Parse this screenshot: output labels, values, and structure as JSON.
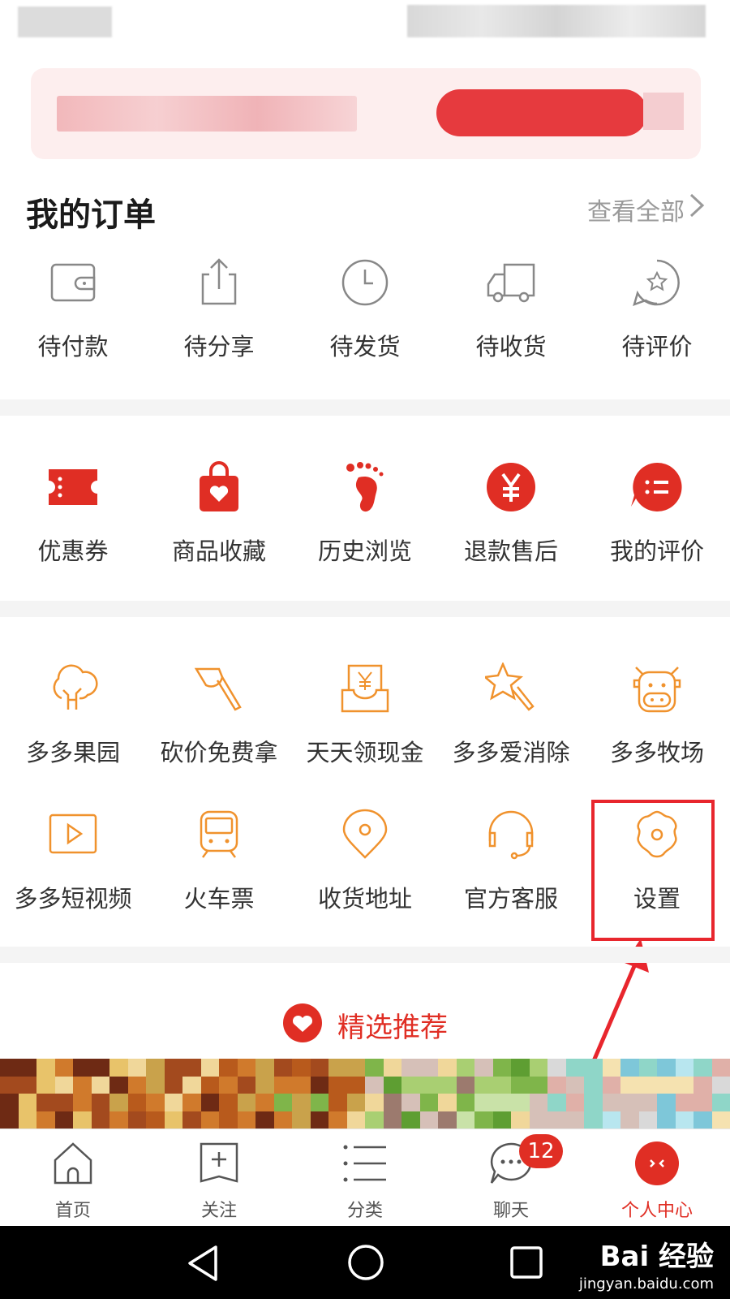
{
  "orders": {
    "title": "我的订单",
    "view_all": "查看全部",
    "items": [
      {
        "label": "待付款",
        "icon": "wallet-icon"
      },
      {
        "label": "待分享",
        "icon": "share-icon"
      },
      {
        "label": "待发货",
        "icon": "clock-icon"
      },
      {
        "label": "待收货",
        "icon": "truck-icon"
      },
      {
        "label": "待评价",
        "icon": "star-chat-icon"
      }
    ]
  },
  "services": {
    "items": [
      {
        "label": "优惠券",
        "icon": "coupon-icon"
      },
      {
        "label": "商品收藏",
        "icon": "bag-heart-icon"
      },
      {
        "label": "历史浏览",
        "icon": "footprint-icon"
      },
      {
        "label": "退款售后",
        "icon": "yen-icon"
      },
      {
        "label": "我的评价",
        "icon": "review-icon"
      }
    ]
  },
  "features": {
    "row1": [
      {
        "label": "多多果园",
        "icon": "tree-icon"
      },
      {
        "label": "砍价免费拿",
        "icon": "axe-icon"
      },
      {
        "label": "天天领现金",
        "icon": "cash-icon"
      },
      {
        "label": "多多爱消除",
        "icon": "star-wand-icon"
      },
      {
        "label": "多多牧场",
        "icon": "cow-icon"
      }
    ],
    "row2": [
      {
        "label": "多多短视频",
        "icon": "video-icon"
      },
      {
        "label": "火车票",
        "icon": "train-icon"
      },
      {
        "label": "收货地址",
        "icon": "location-icon"
      },
      {
        "label": "官方客服",
        "icon": "headset-icon"
      },
      {
        "label": "设置",
        "icon": "gear-icon"
      }
    ]
  },
  "recommend": {
    "label": "精选推荐"
  },
  "tabbar": {
    "tabs": [
      {
        "label": "首页",
        "icon": "home-icon"
      },
      {
        "label": "关注",
        "icon": "follow-icon"
      },
      {
        "label": "分类",
        "icon": "list-icon"
      },
      {
        "label": "聊天",
        "icon": "chat-icon",
        "badge": "12"
      },
      {
        "label": "个人中心",
        "icon": "profile-icon",
        "active": true
      }
    ]
  },
  "watermark": {
    "brand": "Bai 经验",
    "url": "jingyan.baidu.com"
  },
  "colors": {
    "accent": "#e02e24",
    "orange": "#f0922d",
    "highlight": "#e8262d"
  }
}
